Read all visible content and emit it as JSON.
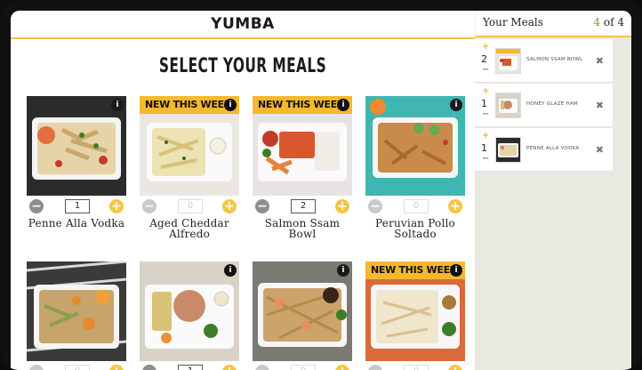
{
  "header": {
    "logo": "YUMBA"
  },
  "page": {
    "heading": "SELECT YOUR MEALS"
  },
  "meals": [
    {
      "name": "Penne Alla Vodka",
      "qty": "1",
      "banner": "",
      "active": true
    },
    {
      "name": "Aged Cheddar Alfredo",
      "qty": "0",
      "banner": "NEW THIS WEEK",
      "active": false
    },
    {
      "name": "Salmon Ssam Bowl",
      "qty": "2",
      "banner": "NEW THIS WEEK",
      "active": true
    },
    {
      "name": "Peruvian Pollo Soltado",
      "qty": "0",
      "banner": "",
      "active": false
    },
    {
      "name": "",
      "qty": "0",
      "banner": "",
      "active": false
    },
    {
      "name": "",
      "qty": "1",
      "banner": "",
      "active": true
    },
    {
      "name": "",
      "qty": "0",
      "banner": "",
      "active": false
    },
    {
      "name": "",
      "qty": "0",
      "banner": "NEW THIS WEEK",
      "active": false
    }
  ],
  "sidebar": {
    "title": "Your Meals",
    "count_current": "4",
    "count_suffix": "of 4",
    "items": [
      {
        "qty": "2",
        "name": "SALMON SSAM BOWL"
      },
      {
        "qty": "1",
        "name": "HONEY GLAZE HAM"
      },
      {
        "qty": "1",
        "name": "PENNE ALLA VODKA"
      }
    ]
  },
  "icons": {
    "info": "info-icon",
    "plus": "plus-icon",
    "minus": "minus-icon",
    "remove": "close-icon"
  },
  "colors": {
    "accent": "#f5b82e",
    "plus_button": "#f5c543",
    "count_green": "#6f9a3a",
    "sidebar_bg": "#e9e8e1"
  },
  "glyphs": {
    "info": "i",
    "plus": "+",
    "minus": "−",
    "remove": "✖"
  }
}
